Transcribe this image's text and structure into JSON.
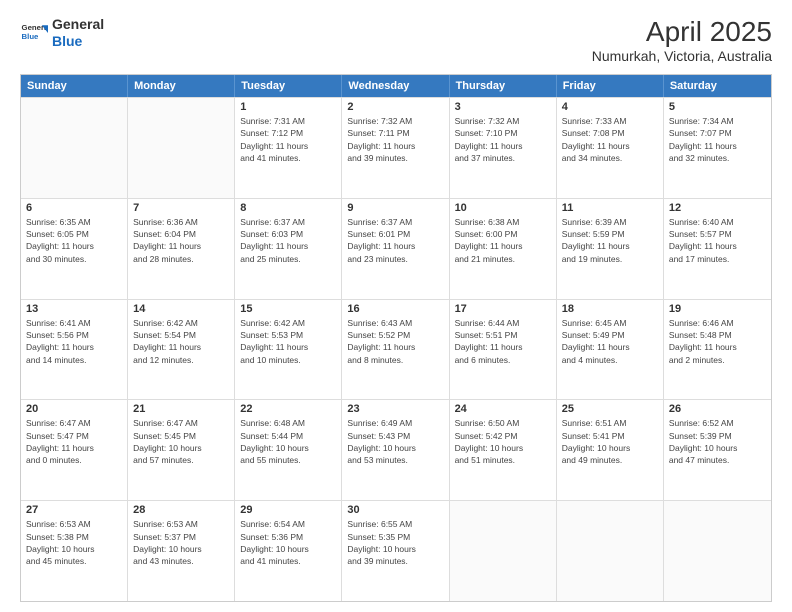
{
  "header": {
    "logo_line1": "General",
    "logo_line2": "Blue",
    "title": "April 2025",
    "subtitle": "Numurkah, Victoria, Australia"
  },
  "weekdays": [
    "Sunday",
    "Monday",
    "Tuesday",
    "Wednesday",
    "Thursday",
    "Friday",
    "Saturday"
  ],
  "weeks": [
    [
      {
        "day": "",
        "info": ""
      },
      {
        "day": "",
        "info": ""
      },
      {
        "day": "1",
        "info": "Sunrise: 7:31 AM\nSunset: 7:12 PM\nDaylight: 11 hours\nand 41 minutes."
      },
      {
        "day": "2",
        "info": "Sunrise: 7:32 AM\nSunset: 7:11 PM\nDaylight: 11 hours\nand 39 minutes."
      },
      {
        "day": "3",
        "info": "Sunrise: 7:32 AM\nSunset: 7:10 PM\nDaylight: 11 hours\nand 37 minutes."
      },
      {
        "day": "4",
        "info": "Sunrise: 7:33 AM\nSunset: 7:08 PM\nDaylight: 11 hours\nand 34 minutes."
      },
      {
        "day": "5",
        "info": "Sunrise: 7:34 AM\nSunset: 7:07 PM\nDaylight: 11 hours\nand 32 minutes."
      }
    ],
    [
      {
        "day": "6",
        "info": "Sunrise: 6:35 AM\nSunset: 6:05 PM\nDaylight: 11 hours\nand 30 minutes."
      },
      {
        "day": "7",
        "info": "Sunrise: 6:36 AM\nSunset: 6:04 PM\nDaylight: 11 hours\nand 28 minutes."
      },
      {
        "day": "8",
        "info": "Sunrise: 6:37 AM\nSunset: 6:03 PM\nDaylight: 11 hours\nand 25 minutes."
      },
      {
        "day": "9",
        "info": "Sunrise: 6:37 AM\nSunset: 6:01 PM\nDaylight: 11 hours\nand 23 minutes."
      },
      {
        "day": "10",
        "info": "Sunrise: 6:38 AM\nSunset: 6:00 PM\nDaylight: 11 hours\nand 21 minutes."
      },
      {
        "day": "11",
        "info": "Sunrise: 6:39 AM\nSunset: 5:59 PM\nDaylight: 11 hours\nand 19 minutes."
      },
      {
        "day": "12",
        "info": "Sunrise: 6:40 AM\nSunset: 5:57 PM\nDaylight: 11 hours\nand 17 minutes."
      }
    ],
    [
      {
        "day": "13",
        "info": "Sunrise: 6:41 AM\nSunset: 5:56 PM\nDaylight: 11 hours\nand 14 minutes."
      },
      {
        "day": "14",
        "info": "Sunrise: 6:42 AM\nSunset: 5:54 PM\nDaylight: 11 hours\nand 12 minutes."
      },
      {
        "day": "15",
        "info": "Sunrise: 6:42 AM\nSunset: 5:53 PM\nDaylight: 11 hours\nand 10 minutes."
      },
      {
        "day": "16",
        "info": "Sunrise: 6:43 AM\nSunset: 5:52 PM\nDaylight: 11 hours\nand 8 minutes."
      },
      {
        "day": "17",
        "info": "Sunrise: 6:44 AM\nSunset: 5:51 PM\nDaylight: 11 hours\nand 6 minutes."
      },
      {
        "day": "18",
        "info": "Sunrise: 6:45 AM\nSunset: 5:49 PM\nDaylight: 11 hours\nand 4 minutes."
      },
      {
        "day": "19",
        "info": "Sunrise: 6:46 AM\nSunset: 5:48 PM\nDaylight: 11 hours\nand 2 minutes."
      }
    ],
    [
      {
        "day": "20",
        "info": "Sunrise: 6:47 AM\nSunset: 5:47 PM\nDaylight: 11 hours\nand 0 minutes."
      },
      {
        "day": "21",
        "info": "Sunrise: 6:47 AM\nSunset: 5:45 PM\nDaylight: 10 hours\nand 57 minutes."
      },
      {
        "day": "22",
        "info": "Sunrise: 6:48 AM\nSunset: 5:44 PM\nDaylight: 10 hours\nand 55 minutes."
      },
      {
        "day": "23",
        "info": "Sunrise: 6:49 AM\nSunset: 5:43 PM\nDaylight: 10 hours\nand 53 minutes."
      },
      {
        "day": "24",
        "info": "Sunrise: 6:50 AM\nSunset: 5:42 PM\nDaylight: 10 hours\nand 51 minutes."
      },
      {
        "day": "25",
        "info": "Sunrise: 6:51 AM\nSunset: 5:41 PM\nDaylight: 10 hours\nand 49 minutes."
      },
      {
        "day": "26",
        "info": "Sunrise: 6:52 AM\nSunset: 5:39 PM\nDaylight: 10 hours\nand 47 minutes."
      }
    ],
    [
      {
        "day": "27",
        "info": "Sunrise: 6:53 AM\nSunset: 5:38 PM\nDaylight: 10 hours\nand 45 minutes."
      },
      {
        "day": "28",
        "info": "Sunrise: 6:53 AM\nSunset: 5:37 PM\nDaylight: 10 hours\nand 43 minutes."
      },
      {
        "day": "29",
        "info": "Sunrise: 6:54 AM\nSunset: 5:36 PM\nDaylight: 10 hours\nand 41 minutes."
      },
      {
        "day": "30",
        "info": "Sunrise: 6:55 AM\nSunset: 5:35 PM\nDaylight: 10 hours\nand 39 minutes."
      },
      {
        "day": "",
        "info": ""
      },
      {
        "day": "",
        "info": ""
      },
      {
        "day": "",
        "info": ""
      }
    ]
  ]
}
